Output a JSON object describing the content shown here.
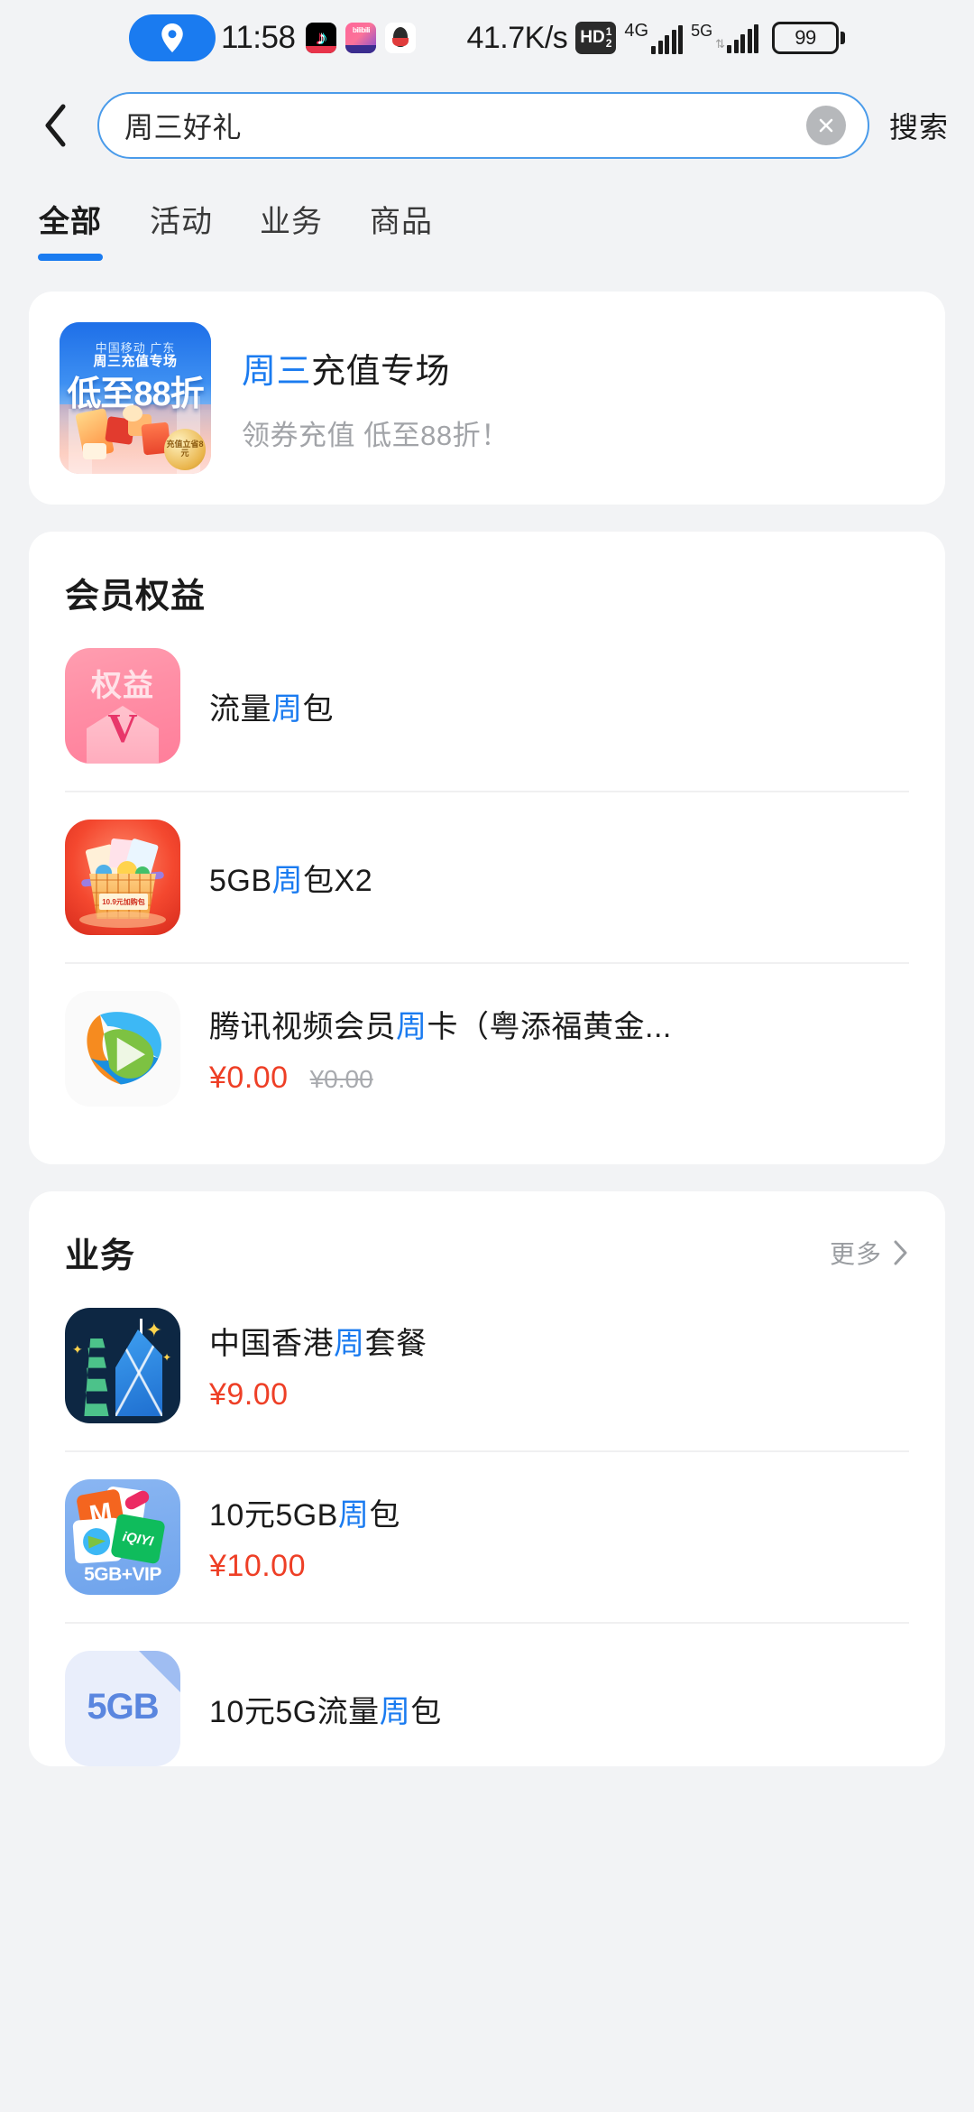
{
  "status_bar": {
    "time": "11:58",
    "network_speed": "41.7K/s",
    "hd_label": "HD",
    "hd_sup": "1",
    "hd_sub": "2",
    "net1_label": "4G",
    "net2_label": "5G",
    "battery_level": "99",
    "location_icon": "location-pin-icon",
    "app_icons": [
      "tiktok-icon",
      "bilibili-icon",
      "qq-icon"
    ]
  },
  "header": {
    "back_icon": "back-chevron-icon",
    "search_value": "周三好礼",
    "search_placeholder": "搜索",
    "clear_icon": "clear-circle-icon",
    "search_button": "搜索"
  },
  "tabs": [
    {
      "label": "全部",
      "active": true
    },
    {
      "label": "活动",
      "active": false
    },
    {
      "label": "业务",
      "active": false
    },
    {
      "label": "商品",
      "active": false
    }
  ],
  "promo": {
    "thumb_top": "中国移动 广东",
    "thumb_sub": "周三充值专场",
    "thumb_main": "低至88折",
    "thumb_coin": "充值立省8元",
    "title_pre": "周三",
    "title_post": "充值专场",
    "subtitle": "领券充值 低至88折！"
  },
  "sections": [
    {
      "title": "会员权益",
      "more_label": "",
      "has_more": false,
      "items": [
        {
          "icon": "quanyi-badge-icon",
          "icon_text": "权益",
          "icon_letter": "V",
          "name_pre": "流量",
          "name_hl": "周",
          "name_post": "包",
          "price": "",
          "price_old": ""
        },
        {
          "icon": "gift-basket-icon",
          "icon_text": "10.9元加购包",
          "name_pre": "5GB",
          "name_hl": "周",
          "name_post": "包X2",
          "price": "",
          "price_old": ""
        },
        {
          "icon": "tencent-video-icon",
          "name_pre": "腾讯视频会员",
          "name_hl": "周",
          "name_post": "卡（粤添福黄金...",
          "price": "¥0.00",
          "price_old": "¥0.00"
        }
      ]
    },
    {
      "title": "业务",
      "more_label": "更多",
      "has_more": true,
      "items": [
        {
          "icon": "hongkong-skyline-icon",
          "name_pre": "中国香港",
          "name_hl": "周",
          "name_post": "套餐",
          "price": "¥9.00",
          "price_old": ""
        },
        {
          "icon": "vip-bundle-icon",
          "icon_text": "5GB+VIP",
          "name_pre": "10元5GB",
          "name_hl": "周",
          "name_post": "包",
          "price": "¥10.00",
          "price_old": ""
        },
        {
          "icon": "data-pack-5gb-icon",
          "icon_text": "5GB",
          "name_pre": "10元5G流量",
          "name_hl": "周",
          "name_post": "包",
          "price": "",
          "price_old": ""
        }
      ]
    }
  ]
}
